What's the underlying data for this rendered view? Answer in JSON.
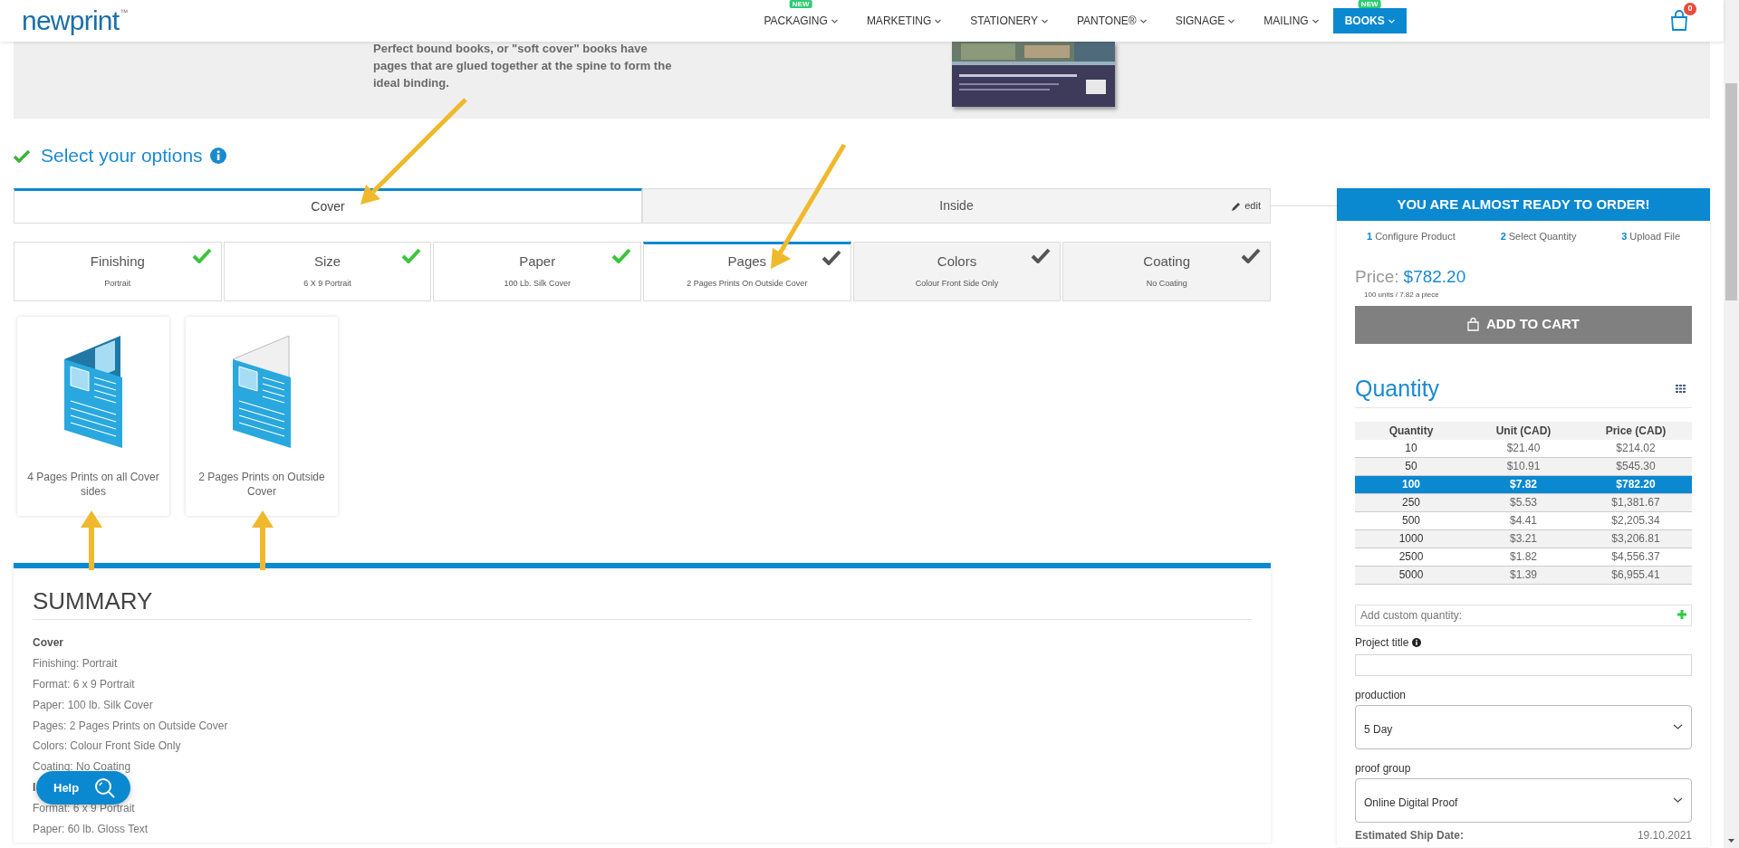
{
  "header": {
    "logo": "newprint",
    "logo_mark": "™",
    "nav": [
      {
        "label": "PACKAGING",
        "badge": "NEW",
        "selected": false
      },
      {
        "label": "MARKETING",
        "selected": false
      },
      {
        "label": "STATIONERY",
        "selected": false
      },
      {
        "label": "PANTONE®",
        "selected": false
      },
      {
        "label": "SIGNAGE",
        "selected": false
      },
      {
        "label": "MAILING",
        "selected": false
      },
      {
        "label": "BOOKS",
        "badge": "NEW",
        "selected": true
      }
    ],
    "cart_count": "0"
  },
  "hero": {
    "text": "Perfect bound books, or \"soft cover\" books have pages that are glued together at the spine to form the ideal binding."
  },
  "options": {
    "title": "Select your options",
    "sections": [
      {
        "label": "Cover",
        "selected": true
      },
      {
        "label": "Inside",
        "selected": false
      }
    ],
    "edit_link": "edit",
    "steps": [
      {
        "title": "Finishing",
        "value": "Portrait",
        "done": true,
        "selected": false
      },
      {
        "title": "Size",
        "value": "6 X 9 Portrait",
        "done": true,
        "selected": false
      },
      {
        "title": "Paper",
        "value": "100 Lb. Silk Cover",
        "done": true,
        "selected": false
      },
      {
        "title": "Pages",
        "value": "2 Pages Prints On Outside Cover",
        "done": false,
        "selected": true
      },
      {
        "title": "Colors",
        "value": "Colour Front Side Only",
        "done": false,
        "selected": false
      },
      {
        "title": "Coating",
        "value": "No Coating",
        "done": false,
        "selected": false
      }
    ],
    "choices": [
      {
        "label": "4 Pages Prints on all Cover sides",
        "kind": "all-sides"
      },
      {
        "label": "2 Pages Prints on Outside Cover",
        "kind": "outside"
      }
    ]
  },
  "summary": {
    "title": "SUMMARY",
    "lines": [
      {
        "text": "Cover",
        "kind": "heading"
      },
      {
        "text": "Finishing: Portrait",
        "kind": "item"
      },
      {
        "text": "Format: 6 x 9 Portrait",
        "kind": "item"
      },
      {
        "text": "Paper: 100 lb. Silk Cover",
        "kind": "item"
      },
      {
        "text": "Pages: 2 Pages Prints on Outside Cover",
        "kind": "item"
      },
      {
        "text": "Colors: Colour Front Side Only",
        "kind": "item"
      },
      {
        "text": "Coating: No Coating",
        "kind": "item"
      },
      {
        "text": "I",
        "kind": "heading"
      },
      {
        "text": "Format: 6 x 9 Portrait",
        "kind": "item"
      },
      {
        "text": "Paper: 60 lb. Gloss Text",
        "kind": "item"
      }
    ]
  },
  "help_button": "Help",
  "order": {
    "banner": "YOU ARE ALMOST READY TO ORDER!",
    "steps": [
      {
        "number": "1",
        "label": "Configure Product"
      },
      {
        "number": "2",
        "label": "Select Quantity"
      },
      {
        "number": "3",
        "label": "Upload File"
      }
    ],
    "price_label": "Price:",
    "price": "$782.20",
    "price_note": "100 units / 7.82 a piece",
    "add_to_cart": "ADD TO CART",
    "quantity_title": "Quantity",
    "table": {
      "columns": [
        "Quantity",
        "Unit (CAD)",
        "Price (CAD)"
      ],
      "rows": [
        {
          "cells": [
            "10",
            "$21.40",
            "$214.02"
          ],
          "selected": false
        },
        {
          "cells": [
            "50",
            "$10.91",
            "$545.30"
          ],
          "selected": false
        },
        {
          "cells": [
            "100",
            "$7.82",
            "$782.20"
          ],
          "selected": true
        },
        {
          "cells": [
            "250",
            "$5.53",
            "$1,381.67"
          ],
          "selected": false
        },
        {
          "cells": [
            "500",
            "$4.41",
            "$2,205.34"
          ],
          "selected": false
        },
        {
          "cells": [
            "1000",
            "$3.21",
            "$3,206.81"
          ],
          "selected": false
        },
        {
          "cells": [
            "2500",
            "$1.82",
            "$4,556.37"
          ],
          "selected": false
        },
        {
          "cells": [
            "5000",
            "$1.39",
            "$6,955.41"
          ],
          "selected": false
        }
      ]
    },
    "custom_quantity": {
      "placeholder": "Add custom quantity:"
    },
    "project_title": {
      "label": "Project title"
    },
    "production": {
      "label": "production",
      "value": "5 Day"
    },
    "proof_group": {
      "label": "proof group",
      "value": "Online Digital Proof"
    },
    "ship_date": {
      "label": "Estimated Ship Date:",
      "value": "19.10.2021"
    }
  }
}
